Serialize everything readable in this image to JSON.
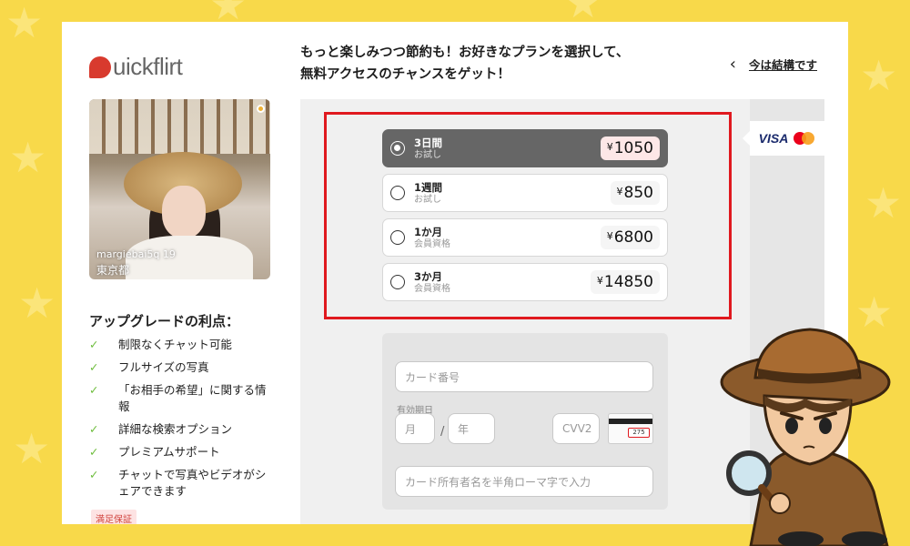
{
  "brand": {
    "logo_text": "uickflirt",
    "accent": "#d83a2e"
  },
  "profile": {
    "username": "margiebai5q 19",
    "city": "東京都"
  },
  "benefits": {
    "title": "アップグレードの利点：",
    "items": [
      "制限なくチャット可能",
      "フルサイズの写真",
      "「お相手の希望」に関する情報",
      "詳細な検索オプション",
      "プレミアムサポート",
      "チャットで写真やビデオがシェアできます"
    ],
    "guarantee": "満足保証"
  },
  "header": {
    "headline_line1": "もっと楽しみつつ節約も！お好きなプランを選択して、",
    "headline_line2": "無料アクセスのチャンスをゲット！",
    "skip_link": "今は結構です"
  },
  "payment_brands": {
    "visa": "VISA",
    "mastercard_icon": "mastercard-icon"
  },
  "plans": [
    {
      "title": "3日間",
      "subtitle": "お試し",
      "currency": "¥",
      "price": "1050",
      "selected": true
    },
    {
      "title": "1週間",
      "subtitle": "お試し",
      "currency": "¥",
      "price": "850",
      "selected": false
    },
    {
      "title": "1か月",
      "subtitle": "会員資格",
      "currency": "¥",
      "price": "6800",
      "selected": false
    },
    {
      "title": "3か月",
      "subtitle": "会員資格",
      "currency": "¥",
      "price": "14850",
      "selected": false
    }
  ],
  "card_form": {
    "card_number_placeholder": "カード番号",
    "expiry_label": "有効期日",
    "month_placeholder": "月",
    "year_placeholder": "年",
    "cvv_placeholder": "CVV2",
    "cvv_sample": "275",
    "holder_placeholder": "カード所有者名を半角ローマ字で入力"
  },
  "colors": {
    "background": "#f8d94a",
    "highlight_border": "#e0191f",
    "selected_plan": "#666666",
    "check": "#6dbd3c"
  }
}
